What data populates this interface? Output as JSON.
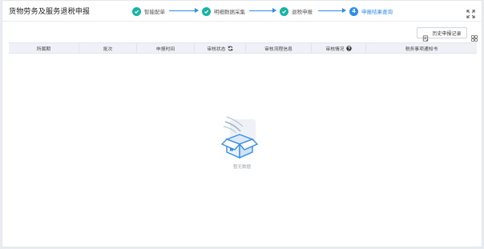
{
  "header": {
    "title": "货物劳务及服务退税申报",
    "steps": [
      {
        "index": "1",
        "label": "智能配单",
        "state": "done"
      },
      {
        "index": "2",
        "label": "明细数据采集",
        "state": "done"
      },
      {
        "index": "3",
        "label": "退税申报",
        "state": "done"
      },
      {
        "index": "4",
        "label": "申报结果查询",
        "state": "active"
      }
    ],
    "fullscreen_icon": "fullscreen-icon"
  },
  "toolbar": {
    "history_label": "历史申报记录",
    "history_icon": "document-icon",
    "grid_icon": "grid-icon"
  },
  "table": {
    "columns": [
      "所属期",
      "批次",
      "申报时间",
      "审核状态",
      "审核流程信息",
      "审核情况",
      "税务事项通知书"
    ],
    "rows": []
  },
  "empty_state": {
    "text": "暂无数据",
    "icon": "empty-box-icon"
  },
  "colors": {
    "step_done": "#17b3a3",
    "step_active": "#2d8cf0",
    "box_blue": "#3a8ee6"
  }
}
